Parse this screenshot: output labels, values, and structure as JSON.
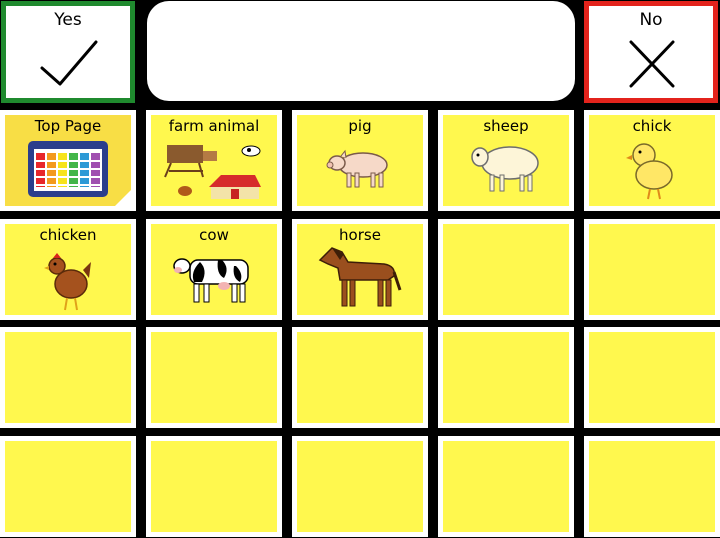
{
  "yes_button": {
    "label": "Yes",
    "icon": "checkmark-icon",
    "border_color": "#1f8a2e"
  },
  "no_button": {
    "label": "No",
    "icon": "cross-icon",
    "border_color": "#e3231c"
  },
  "message_bar": {
    "text": ""
  },
  "grid": {
    "cell_color": "#fff84e",
    "rows": [
      [
        {
          "label": "Top Page",
          "icon": "table-chart-icon"
        },
        {
          "label": "farm animal",
          "icon": "farm-scene-icon"
        },
        {
          "label": "pig",
          "icon": "pig-icon"
        },
        {
          "label": "sheep",
          "icon": "sheep-icon"
        },
        {
          "label": "chick",
          "icon": "chick-icon"
        }
      ],
      [
        {
          "label": "chicken",
          "icon": "chicken-icon"
        },
        {
          "label": "cow",
          "icon": "cow-icon"
        },
        {
          "label": "horse",
          "icon": "horse-icon"
        },
        {
          "label": "",
          "icon": ""
        },
        {
          "label": "",
          "icon": ""
        }
      ],
      [
        {
          "label": "",
          "icon": ""
        },
        {
          "label": "",
          "icon": ""
        },
        {
          "label": "",
          "icon": ""
        },
        {
          "label": "",
          "icon": ""
        },
        {
          "label": "",
          "icon": ""
        }
      ],
      [
        {
          "label": "",
          "icon": ""
        },
        {
          "label": "",
          "icon": ""
        },
        {
          "label": "",
          "icon": ""
        },
        {
          "label": "",
          "icon": ""
        },
        {
          "label": "",
          "icon": ""
        }
      ]
    ]
  }
}
